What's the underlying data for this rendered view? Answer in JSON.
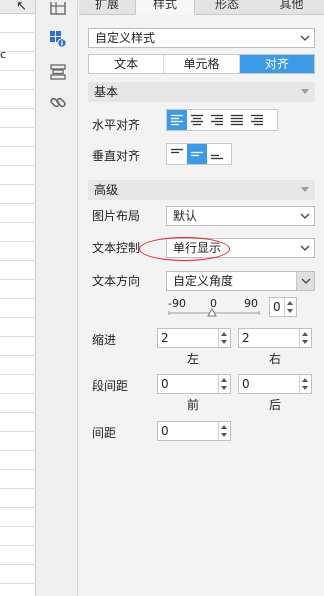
{
  "grid": {
    "cursor_glyph": "↖",
    "cell_text": "c"
  },
  "icons": [
    "grid-icon",
    "cell-style-icon",
    "layout-icon",
    "link-icon"
  ],
  "tabs": [
    {
      "label": "扩展",
      "active": false
    },
    {
      "label": "样式",
      "active": true
    },
    {
      "label": "形态",
      "active": false
    },
    {
      "label": "其他",
      "active": false
    }
  ],
  "style_select": {
    "value": "自定义样式"
  },
  "subtabs": [
    {
      "label": "文本",
      "active": false
    },
    {
      "label": "单元格",
      "active": false
    },
    {
      "label": "对齐",
      "active": true
    }
  ],
  "basic": {
    "title": "基本",
    "horizontal_label": "水平对齐",
    "vertical_label": "垂直对齐"
  },
  "advanced": {
    "title": "高级",
    "image_layout_label": "图片布局",
    "image_layout_value": "默认",
    "text_control_label": "文本控制",
    "text_control_value": "单行显示",
    "text_direction_label": "文本方向",
    "text_direction_value": "自定义角度",
    "angle_min": "-90",
    "angle_mid": "0",
    "angle_max": "90",
    "angle_value": "0",
    "indent_label": "缩进",
    "indent_left_value": "2",
    "indent_right_value": "2",
    "indent_left_caption": "左",
    "indent_right_caption": "右",
    "para_spacing_label": "段间距",
    "para_before_value": "0",
    "para_after_value": "0",
    "para_before_caption": "前",
    "para_after_caption": "后",
    "spacing_label": "间距",
    "spacing_value": "0"
  },
  "colors": {
    "accent": "#3d9ae8",
    "highlight": "#e22222"
  }
}
